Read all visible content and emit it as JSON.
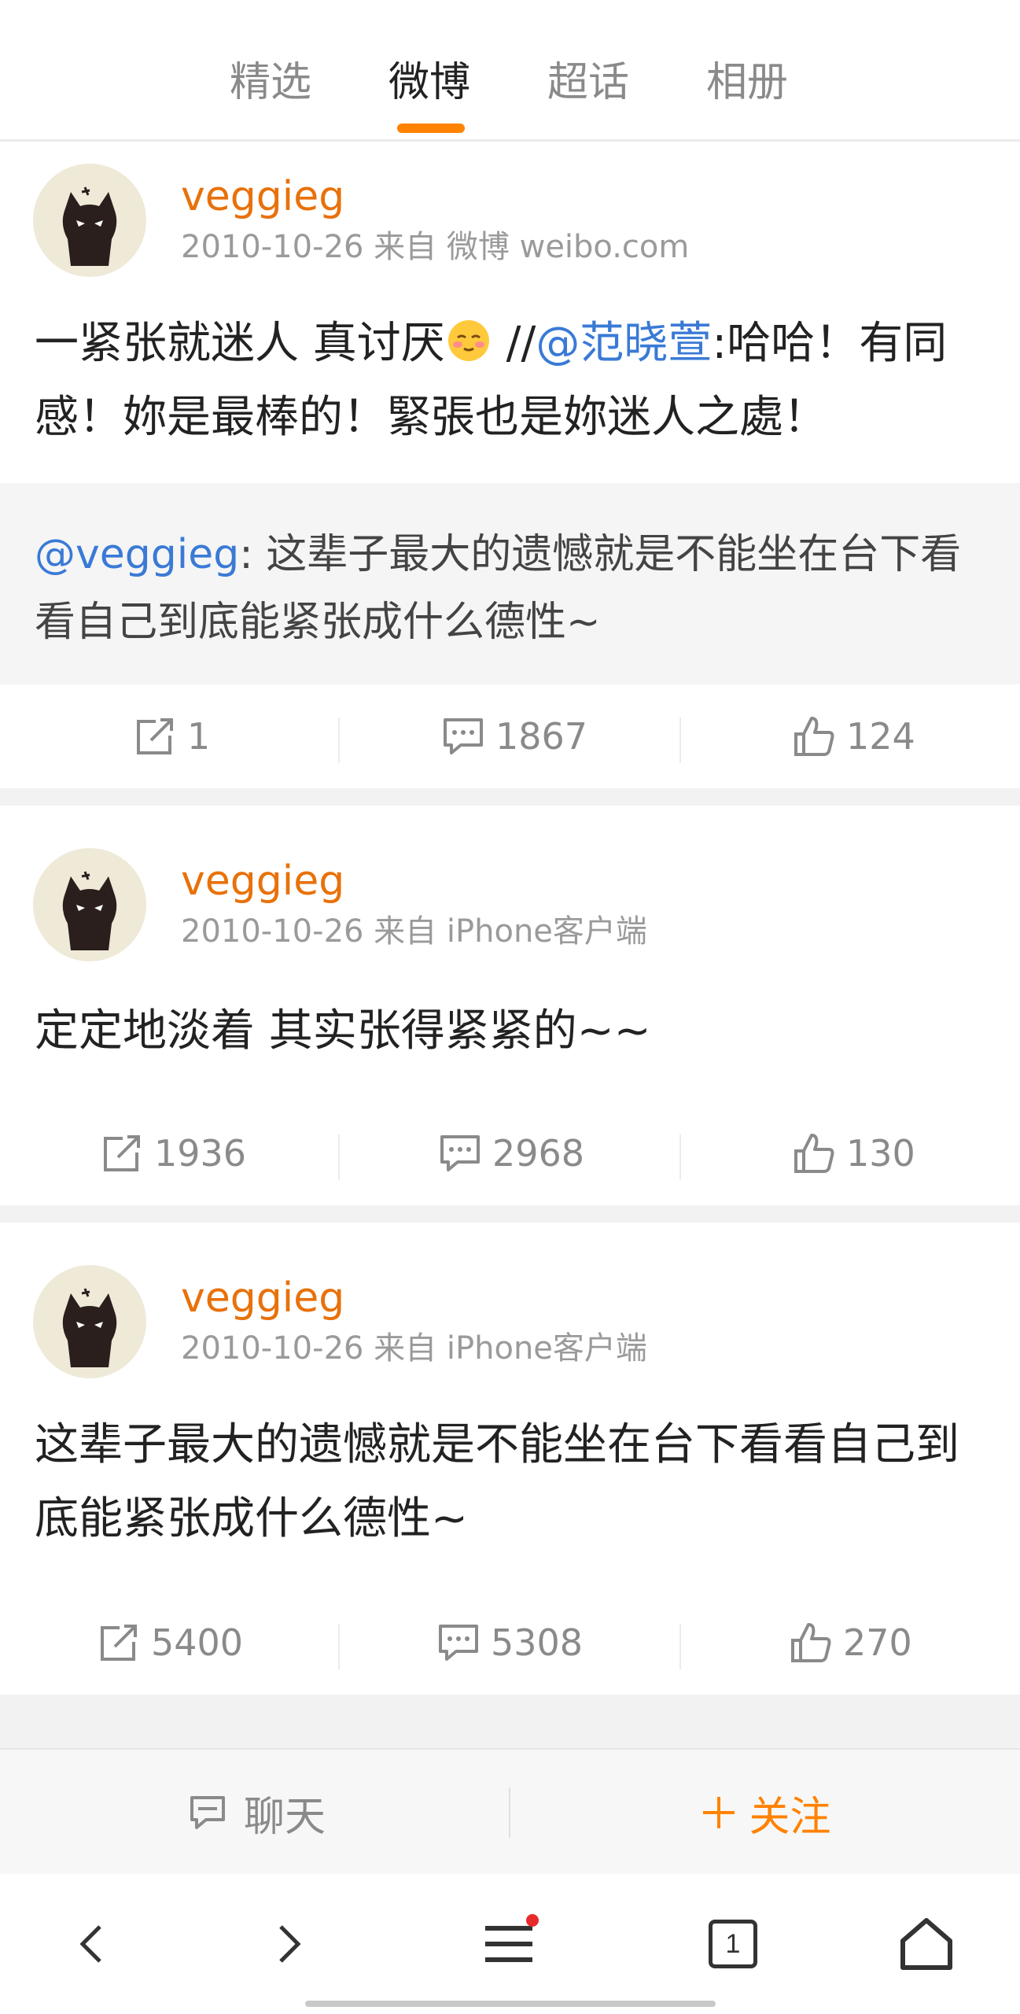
{
  "tabs": [
    {
      "label": "精选",
      "active": false
    },
    {
      "label": "微博",
      "active": true
    },
    {
      "label": "超话",
      "active": false
    },
    {
      "label": "相册",
      "active": false
    }
  ],
  "accent_color": "#ff8200",
  "posts": [
    {
      "username": "veggieg",
      "meta": "2010-10-26 来自 微博 weibo.com",
      "content_part1": "一紧张就迷人 真讨厌",
      "content_emoji": "shy-face-emoji",
      "content_part2": " //",
      "content_mention": "@范晓萱",
      "content_part3": ":哈哈！有同感！妳是最棒的！緊張也是妳迷人之處！",
      "repost_mention": "@veggieg",
      "repost_text": ": 这辈子最大的遗憾就是不能坐在台下看看自己到底能紧张成什么德性~",
      "shares": "1",
      "comments": "1867",
      "likes": "124"
    },
    {
      "username": "veggieg",
      "meta": "2010-10-26 来自 iPhone客户端",
      "content": "定定地淡着 其实张得紧紧的~~",
      "shares": "1936",
      "comments": "2968",
      "likes": "130"
    },
    {
      "username": "veggieg",
      "meta": "2010-10-26 来自 iPhone客户端",
      "content": "这辈子最大的遗憾就是不能坐在台下看看自己到底能紧张成什么德性~",
      "shares": "5400",
      "comments": "5308",
      "likes": "270"
    }
  ],
  "bottom_bar": {
    "chat_label": "聊天",
    "follow_label": "关注"
  },
  "browser_nav": {
    "tab_count": "1"
  }
}
